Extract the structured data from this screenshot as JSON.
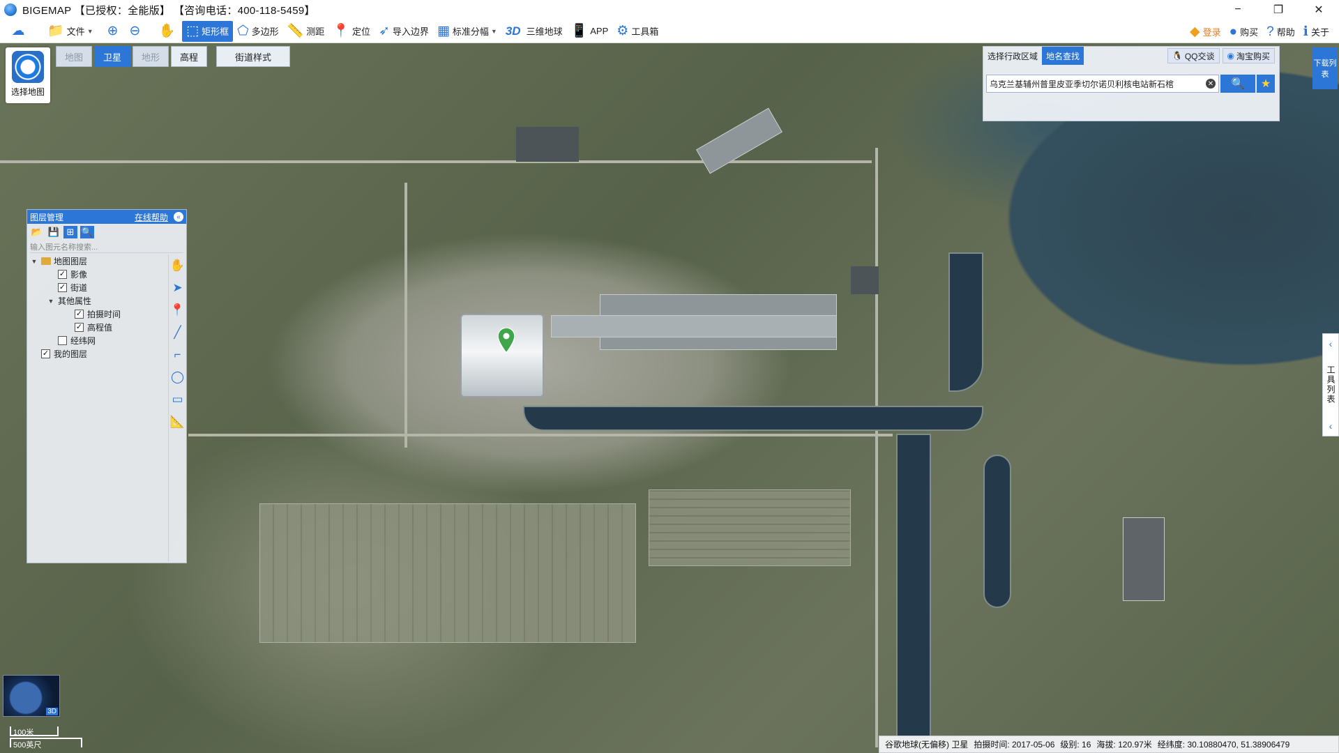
{
  "window": {
    "title": "BIGEMAP 【已授权：全能版】 【咨询电话：400-118-5459】",
    "minimize_glyph": "−",
    "maximize_glyph": "❐",
    "close_glyph": "✕"
  },
  "toolbar": {
    "file_label": "文件",
    "zoom_in_label": "",
    "zoom_out_label": "",
    "rect_label": "矩形框",
    "polygon_label": "多边形",
    "measure_label": "测距",
    "locate_label": "定位",
    "import_boundary_label": "导入边界",
    "grid_label": "标准分幅",
    "three_d_label": "3D",
    "globe_label": "三维地球",
    "app_label": "APP",
    "toolbox_label": "工具箱",
    "login_label": "登录",
    "buy_label": "购买",
    "help_label": "帮助",
    "about_label": "关于",
    "accent_color": "#2b76d6"
  },
  "map_select": {
    "label": "选择地图"
  },
  "map_tabs": [
    {
      "label": "地图",
      "active": false
    },
    {
      "label": "卫星",
      "active": true
    },
    {
      "label": "地形",
      "active": false
    },
    {
      "label": "高程",
      "active": false
    }
  ],
  "street_style_label": "街道样式",
  "search_panel": {
    "tab_region": "选择行政区域",
    "tab_place": "地名查找",
    "qq_label": "QQ交谈",
    "taobao_label": "淘宝购买",
    "query_value": "乌克兰基辅州普里皮亚季切尔诺贝利核电站新石棺"
  },
  "download_list_label": "下载列表",
  "tool_strip_label": "工具列表",
  "layer_panel": {
    "title": "图层管理",
    "help_link": "在线帮助",
    "search_placeholder": "输入图元名称搜索...",
    "tree": {
      "map_layers": "地图图层",
      "imagery": "影像",
      "streets": "街道",
      "other_attrs": "其他属性",
      "capture_time": "拍摄时间",
      "elevation": "高程值",
      "graticule": "经纬网",
      "my_layers": "我的图层"
    }
  },
  "minimap": {
    "badge": "3D"
  },
  "scale": {
    "metric": "100米",
    "imperial": "500英尺"
  },
  "status": {
    "source": "谷歌地球(无偏移) 卫星",
    "capture_time": "拍摄时间: 2017-05-06",
    "level": "级别:  16",
    "altitude": "海拔: 120.97米",
    "coords": "经纬度:   30.10880470, 51.38906479"
  }
}
